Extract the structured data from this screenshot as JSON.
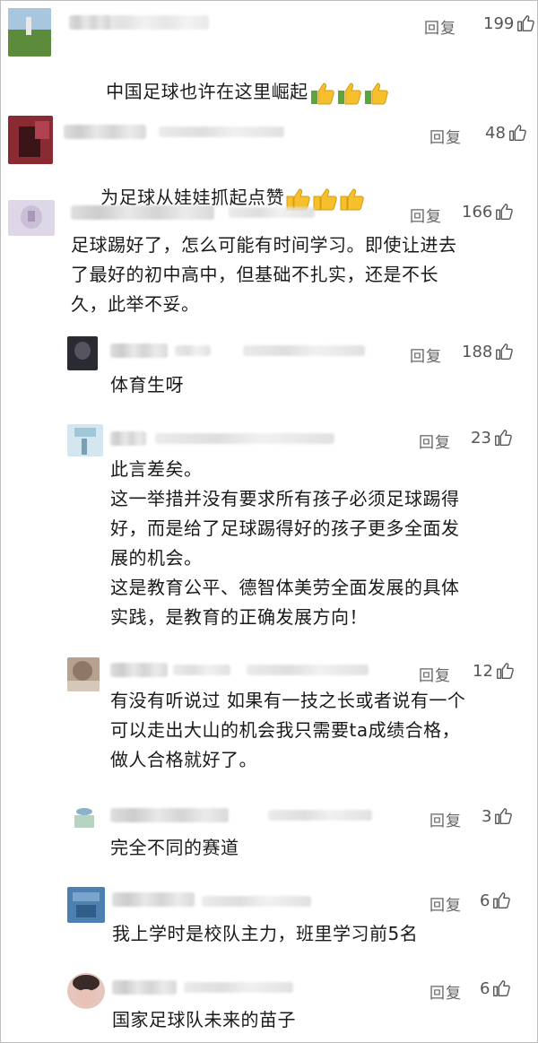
{
  "reply_label": "回复",
  "comments": [
    {
      "likes": "199",
      "text": "中国足球也许在这里崛起",
      "emoji": [
        "thumbs-up",
        "thumbs-up",
        "thumbs-up"
      ]
    },
    {
      "likes": "48",
      "text": "为足球从娃娃抓起点赞",
      "emoji": [
        "thumbs-up",
        "thumbs-up",
        "thumbs-up"
      ]
    },
    {
      "likes": "166",
      "text": "足球踢好了，怎么可能有时间学习。即使让进去\n了最好的初中高中，但基础不扎实，还是不长\n久，此举不妥。"
    },
    {
      "likes": "188",
      "text": "体育生呀"
    },
    {
      "likes": "23",
      "text": "此言差矣。\n这一举措并没有要求所有孩子必须足球踢得\n好，而是给了足球踢得好的孩子更多全面发\n展的机会。\n这是教育公平、德智体美劳全面发展的具体\n实践，是教育的正确发展方向！"
    },
    {
      "likes": "12",
      "text": "有没有听说过 如果有一技之长或者说有一个\n可以走出大山的机会我只需要ta成绩合格，\n做人合格就好了。"
    },
    {
      "likes": "3",
      "text": "完全不同的赛道"
    },
    {
      "likes": "6",
      "text": "我上学时是校队主力，班里学习前5名"
    },
    {
      "likes": "6",
      "text": "国家足球队未来的苗子"
    }
  ],
  "icons": {
    "like": "thumb-up-outline-icon",
    "emoji": "thumbs-up-emoji"
  },
  "colors": {
    "emoji_yellow": "#f5c02c",
    "emoji_green": "#5aa63a",
    "text": "#1a1a1a",
    "meta": "#666666"
  }
}
